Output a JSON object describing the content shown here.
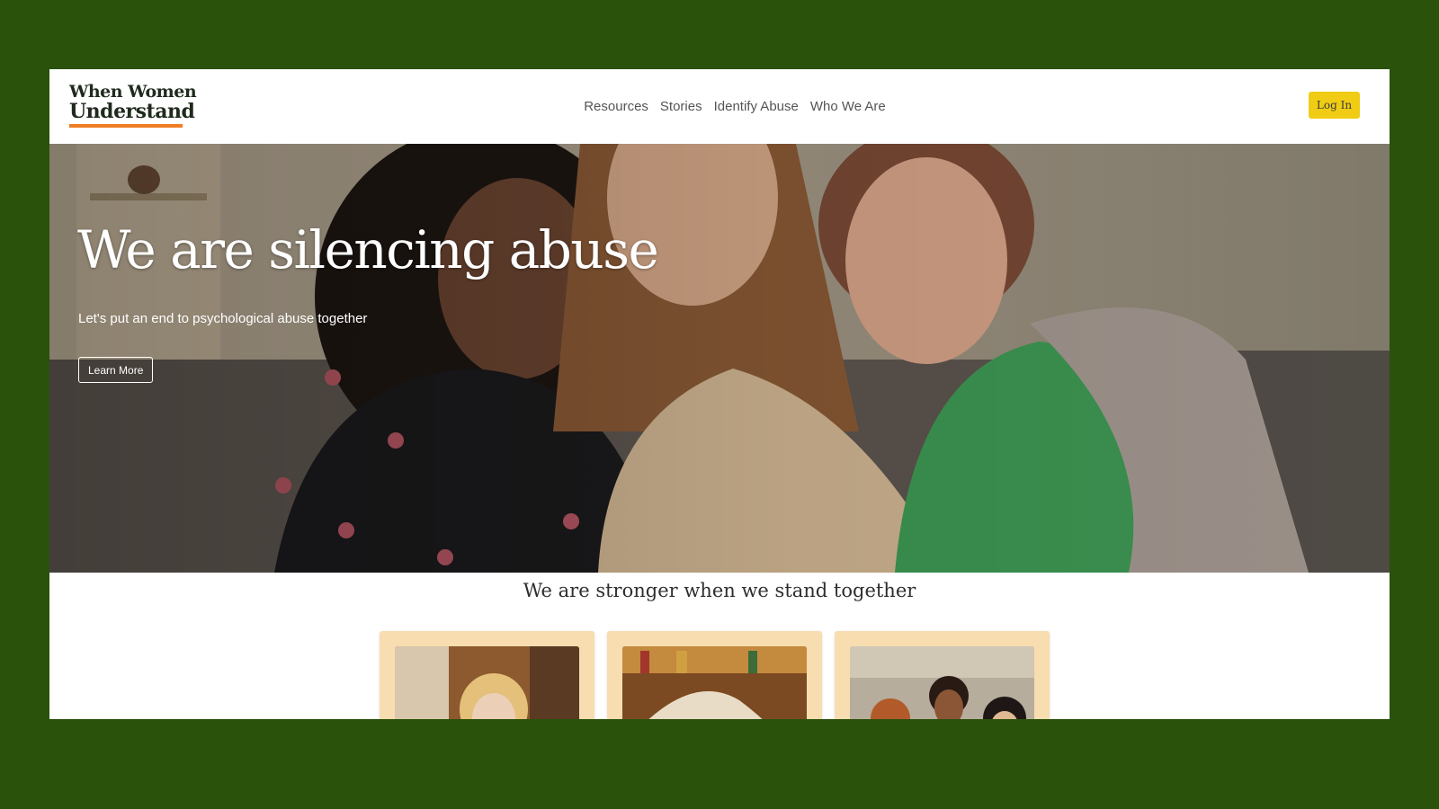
{
  "site": {
    "logo_line1": "When Women",
    "logo_line2": "Understand"
  },
  "nav": {
    "items": [
      "Resources",
      "Stories",
      "Identify Abuse",
      "Who We Are"
    ]
  },
  "header": {
    "login_label": "Log In"
  },
  "hero": {
    "title": "We are silencing abuse",
    "subtitle": "Let's put an end to psychological abuse together",
    "cta_label": "Learn More"
  },
  "section": {
    "title": "We are stronger when we stand together"
  },
  "colors": {
    "page_background": "#2a520b",
    "accent_orange": "#f07d22",
    "login_button": "#f0cc14",
    "card_background": "#f7ddb0"
  }
}
